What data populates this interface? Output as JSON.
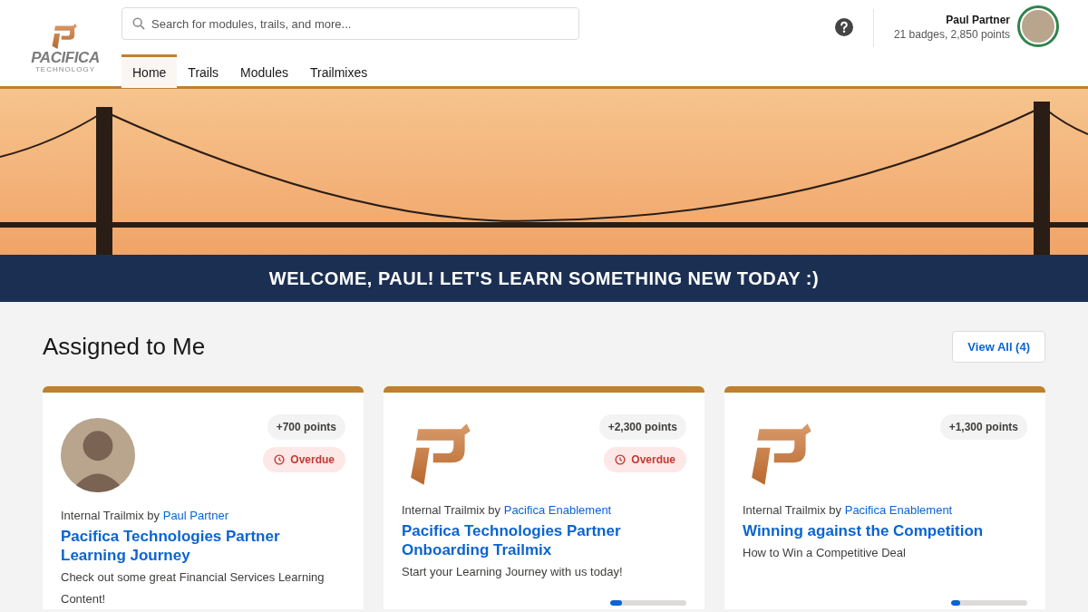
{
  "logo": {
    "name": "PACIFICA",
    "tagline": "TECHNOLOGY"
  },
  "search": {
    "placeholder": "Search for modules, trails, and more..."
  },
  "nav": [
    {
      "label": "Home",
      "selected": true
    },
    {
      "label": "Trails",
      "selected": false
    },
    {
      "label": "Modules",
      "selected": false
    },
    {
      "label": "Trailmixes",
      "selected": false
    }
  ],
  "user": {
    "name": "Paul Partner",
    "stats": "21 badges, 2,850 points"
  },
  "banner": {
    "heading": "WELCOME, PAUL! LET'S LEARN SOMETHING NEW TODAY :)"
  },
  "section": {
    "title": "Assigned to Me",
    "action": "View All (4)"
  },
  "cards": [
    {
      "kind": "person",
      "points": "+700 points",
      "overdue": true,
      "status": "Overdue",
      "prefix": "Internal Trailmix by",
      "author": "Paul Partner",
      "title": "Pacifica Technologies Partner Learning Journey",
      "description": "Check out some great Financial Services Learning Content!"
    },
    {
      "kind": "logo",
      "points": "+2,300 points",
      "overdue": true,
      "status": "Overdue",
      "prefix": "Internal Trailmix by",
      "author": "Pacifica Enablement",
      "title": "Pacifica Technologies Partner Onboarding Trailmix",
      "description": "Start your Learning Journey with us today!",
      "level": 0.15
    },
    {
      "kind": "logo",
      "points": "+1,300 points",
      "overdue": false,
      "prefix": "Internal Trailmix by",
      "author": "Pacifica Enablement",
      "title": "Winning against the Competition",
      "description": "How to Win a Competitive Deal",
      "level": 0.12
    }
  ]
}
